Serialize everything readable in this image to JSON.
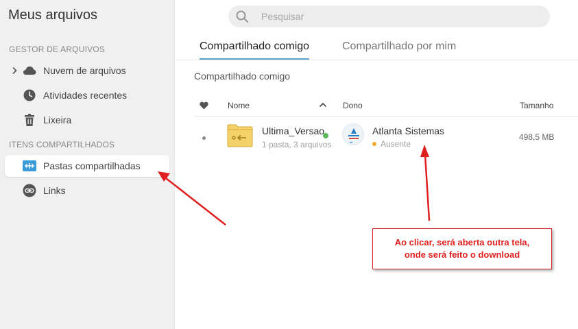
{
  "sidebar": {
    "title": "Meus arquivos",
    "section_files": "GESTOR DE ARQUIVOS",
    "section_shared": "ITENS COMPARTILHADOS",
    "items": [
      {
        "label": "Nuvem de arquivos",
        "icon": "cloud-icon"
      },
      {
        "label": "Atividades recentes",
        "icon": "clock-icon"
      },
      {
        "label": "Lixeira",
        "icon": "trash-icon"
      },
      {
        "label": "Pastas compartilhadas",
        "icon": "shared-folders-icon",
        "active": true
      },
      {
        "label": "Links",
        "icon": "link-icon"
      }
    ]
  },
  "search": {
    "placeholder": "Pesquisar",
    "value": ""
  },
  "tabs": [
    {
      "label": "Compartilhado comigo",
      "active": true
    },
    {
      "label": "Compartilhado por mim",
      "active": false
    }
  ],
  "breadcrumb": "Compartilhado comigo",
  "table": {
    "headers": {
      "name": "Nome",
      "owner": "Dono",
      "size": "Tamanho"
    },
    "rows": [
      {
        "name": "Ultima_Versao",
        "meta": "1 pasta, 3 arquivos",
        "owner": "Atlanta Sistemas",
        "owner_status": "Ausente",
        "size": "498,5 MB"
      }
    ]
  },
  "annotation": {
    "text": "Ao clicar, será aberta outra tela,\nonde será feito o download"
  },
  "colors": {
    "accent": "#5da4d0",
    "shared_icon": "#3a9bd9",
    "folder": "#f5d16a",
    "annotation": "#e02020",
    "online": "#5cb85c",
    "away": "#f0a830"
  }
}
